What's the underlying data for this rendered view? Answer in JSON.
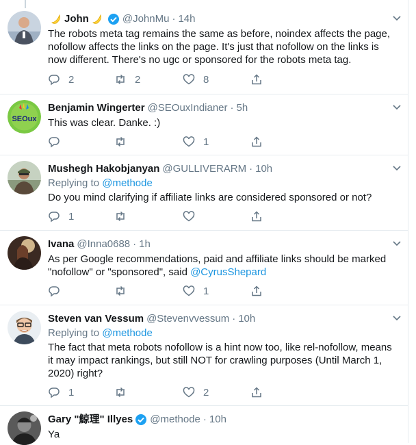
{
  "tweets": [
    {
      "name": "John",
      "handle": "@JohnMu",
      "time": "14h",
      "text": "The robots meta tag remains the same as before, noindex affects the page, nofollow affects the links on the page. It's just that nofollow on the links is now different. There's no ugc or sponsored for the robots meta tag.",
      "replies": "2",
      "retweets": "2",
      "likes": "8"
    },
    {
      "name": "Benjamin Wingerter",
      "handle": "@SEOuxIndianer",
      "time": "5h",
      "avatar_text": "SEOux",
      "text": "This was clear. Danke. :)",
      "replies": "",
      "retweets": "",
      "likes": "1"
    },
    {
      "name": "Mushegh Hakobjanyan",
      "handle": "@GULLIVERARM",
      "time": "10h",
      "replying_label": "Replying to",
      "replying_to": "@methode",
      "text": "Do you mind clarifying if affiliate links are considered sponsored or not?",
      "replies": "1",
      "retweets": "",
      "likes": ""
    },
    {
      "name": "Ivana",
      "handle": "@Inna0688",
      "time": "1h",
      "text": "As per Google recommendations, paid and affiliate links should be marked \"nofollow\" or \"sponsored\", said",
      "mention": "@CyrusShepard",
      "replies": "",
      "retweets": "",
      "likes": "1"
    },
    {
      "name": "Steven van Vessum",
      "handle": "@Stevenvvessum",
      "time": "10h",
      "replying_label": "Replying to",
      "replying_to": "@methode",
      "text": "The fact that meta robots nofollow is a hint now too, like rel-nofollow, means it may impact rankings, but still NOT for crawling purposes (Until March 1, 2020) right?",
      "replies": "1",
      "retweets": "",
      "likes": "2"
    },
    {
      "name": "Gary \"鯨理\" Illyes",
      "handle": "@methode",
      "time": "10h",
      "text": "Ya"
    }
  ],
  "colors": {
    "accent": "#1da1f2",
    "link": "#1b95e0",
    "secondary_text": "#657786",
    "border": "#e6ecf0"
  }
}
